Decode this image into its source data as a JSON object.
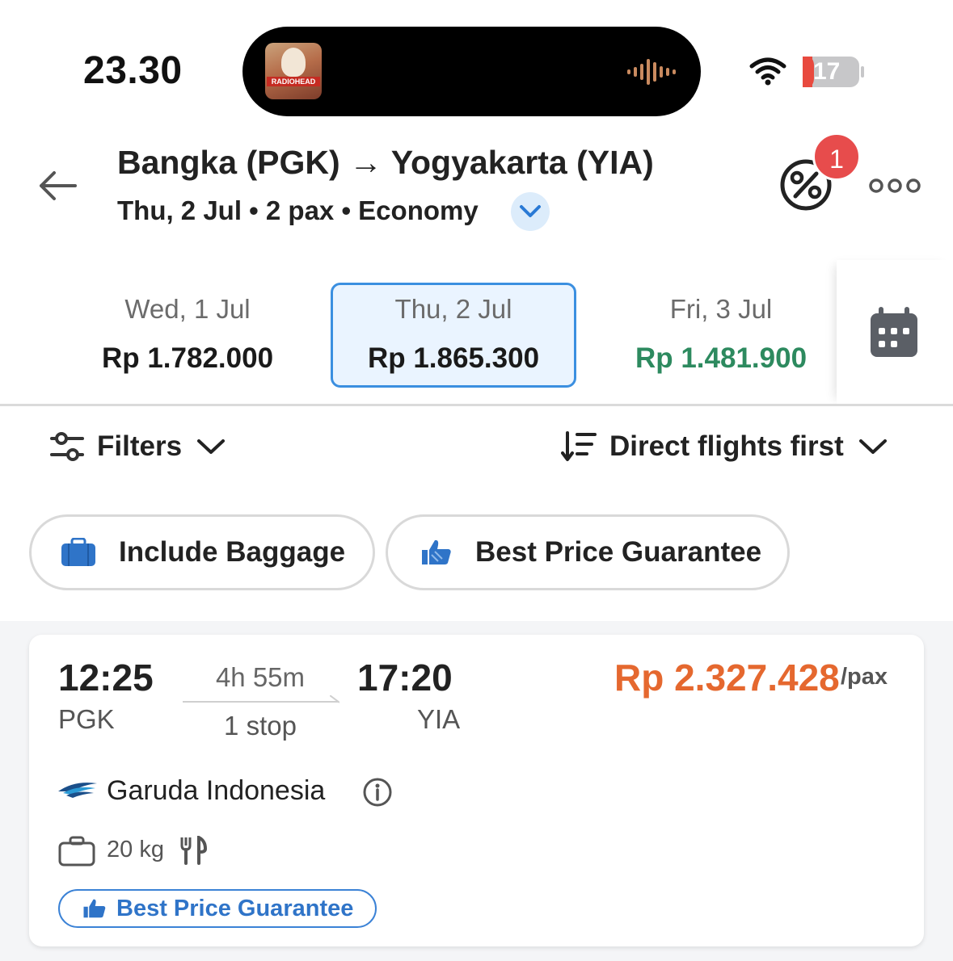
{
  "status_bar": {
    "time": "23.30",
    "now_playing_album_text": "RADIOHEAD",
    "battery_level": "17"
  },
  "header": {
    "route_title": "Bangka (PGK) → Yogyakarta (YIA)",
    "route_subtitle": "Thu, 2 Jul • 2 pax • Economy",
    "promo_badge_count": "1"
  },
  "date_tabs": [
    {
      "date": "Wed, 1 Jul",
      "price": "Rp 1.782.000",
      "selected": false
    },
    {
      "date": "Thu, 2 Jul",
      "price": "Rp 1.865.300",
      "selected": true
    },
    {
      "date": "Fri, 3 Jul",
      "price": "Rp 1.481.900",
      "selected": false,
      "price_color": "#2d8a5f"
    }
  ],
  "filter_bar": {
    "filters_label": "Filters",
    "sort_label": "Direct flights first"
  },
  "chips": {
    "baggage_label": "Include Baggage",
    "guarantee_label": "Best Price Guarantee"
  },
  "flight": {
    "departure_time": "12:25",
    "departure_code": "PGK",
    "duration": "4h 55m",
    "stops": "1 stop",
    "arrival_time": "17:20",
    "arrival_code": "YIA",
    "price": "Rp 2.327.428",
    "price_unit": "/pax",
    "airline": "Garuda Indonesia",
    "baggage": "20 kg",
    "badge_label": "Best Price Guarantee"
  },
  "colors": {
    "accent_blue": "#3b8fe0",
    "price_orange": "#e5682f",
    "cheap_green": "#2d8a5f",
    "badge_red": "#e74c4c"
  }
}
